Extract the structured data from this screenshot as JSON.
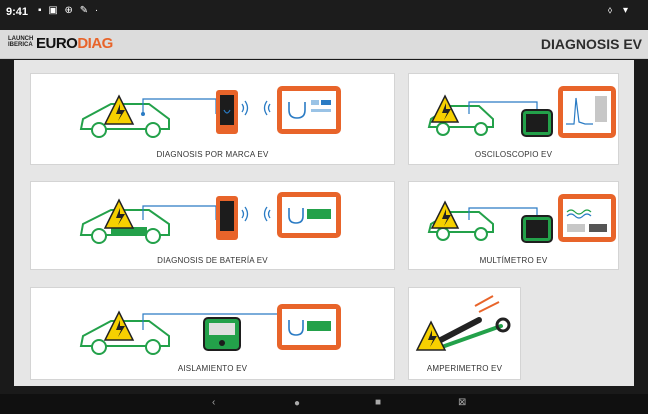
{
  "status": {
    "time": "9:41",
    "left_icons": "▪ ▣ ⊕ ✎ ·",
    "right_icons": "⬨ ▾"
  },
  "brand": {
    "launch_line1": "LAUNCH",
    "launch_line2": "IBERICA",
    "euro": "EURO",
    "diag": "DIAG"
  },
  "header": {
    "title": "DIAGNOSIS EV"
  },
  "cards": [
    {
      "label": "DIAGNOSIS POR MARCA EV"
    },
    {
      "label": "OSCILOSCOPIO EV"
    },
    {
      "label": "DIAGNOSIS DE BATERÍA EV"
    },
    {
      "label": "MULTÍMETRO EV"
    },
    {
      "label": "AISLAMIENTO EV"
    },
    {
      "label": "AMPERIMETRO EV"
    }
  ],
  "colors": {
    "green": "#23a14a",
    "orange": "#e8642a",
    "blue": "#2a7bc4",
    "yellow": "#f6d000"
  }
}
